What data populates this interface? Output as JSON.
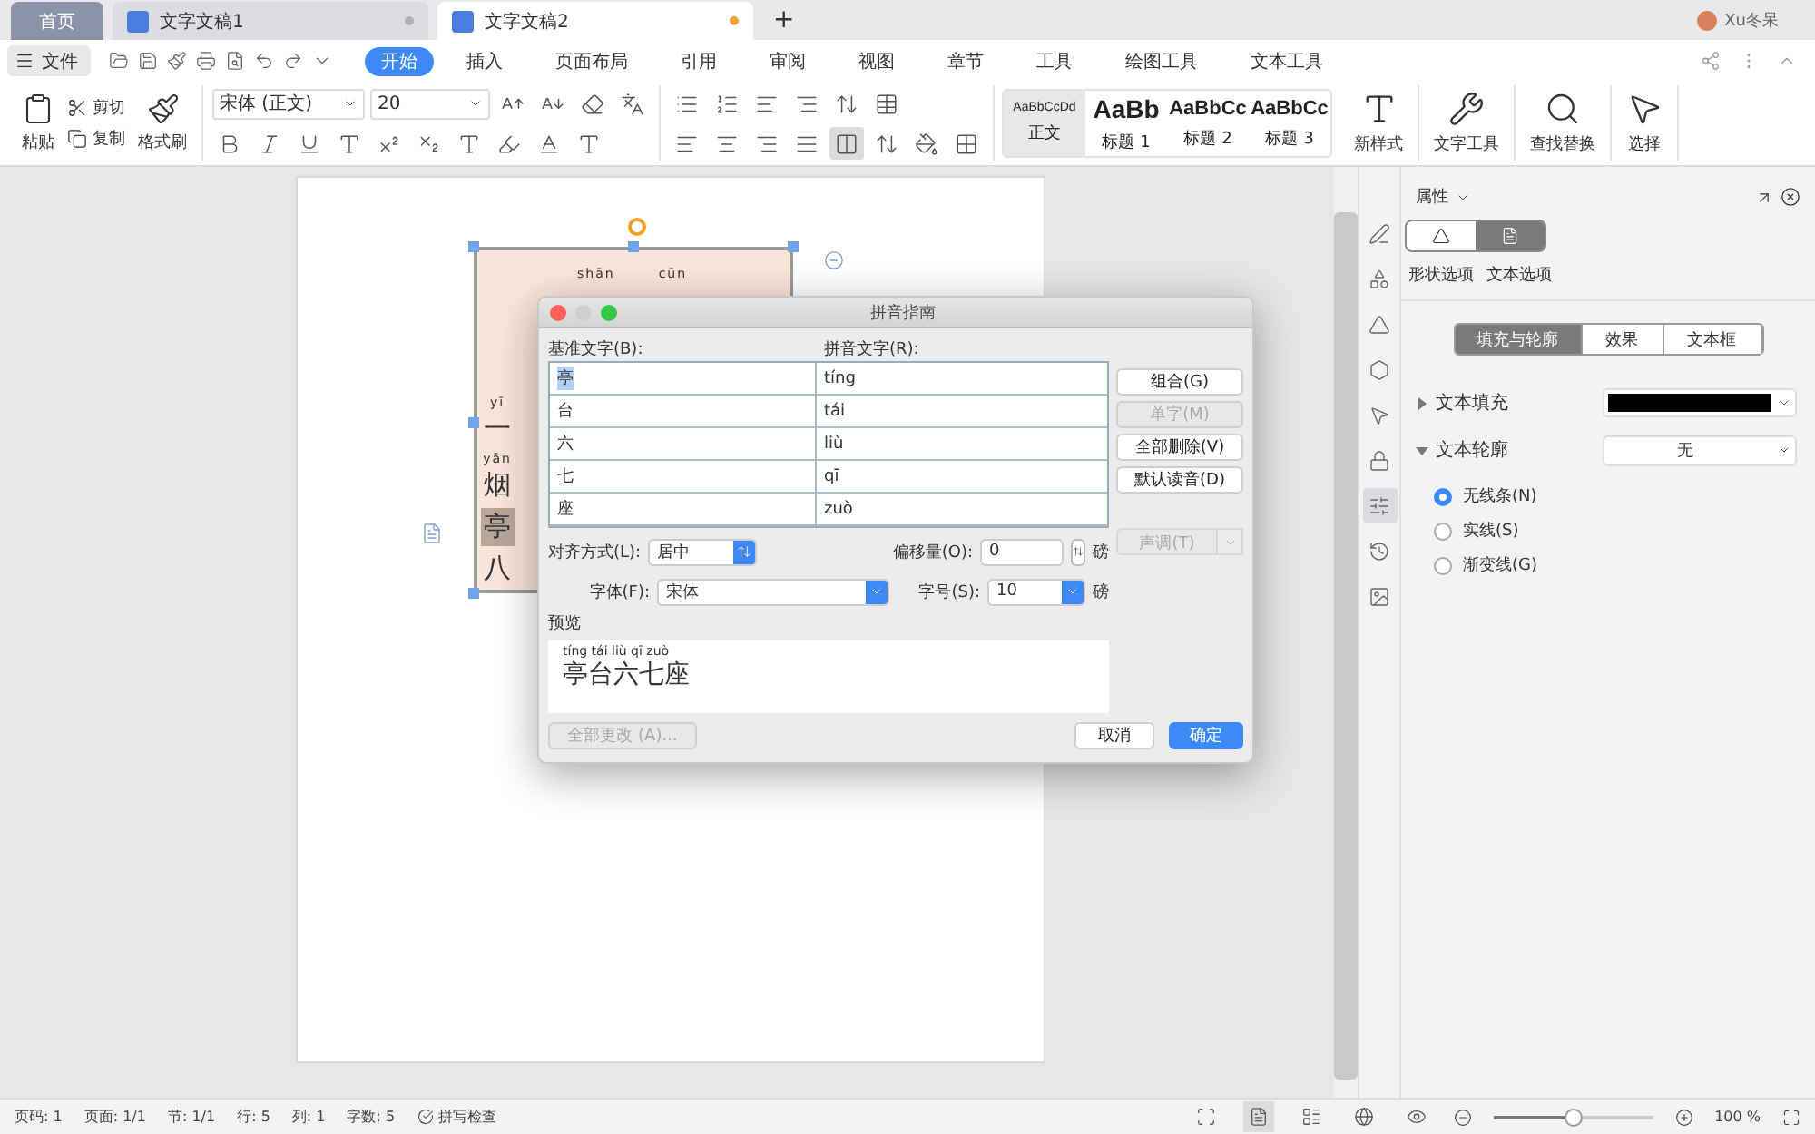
{
  "tabs": [
    {
      "label": "首页",
      "kind": "home",
      "selected": false
    },
    {
      "label": "文字文稿1",
      "kind": "doc",
      "selected": false
    },
    {
      "label": "文字文稿2",
      "kind": "doc",
      "selected": true
    }
  ],
  "new_tab": "+",
  "user": {
    "name": "Xu冬呆"
  },
  "menu": {
    "file": "文件",
    "items": [
      {
        "label": "开始",
        "selected": true
      },
      {
        "label": "插入",
        "selected": false
      },
      {
        "label": "页面布局",
        "selected": false
      },
      {
        "label": "引用",
        "selected": false
      },
      {
        "label": "审阅",
        "selected": false
      },
      {
        "label": "视图",
        "selected": false
      },
      {
        "label": "章节",
        "selected": false
      },
      {
        "label": "工具",
        "selected": false
      },
      {
        "label": "绘图工具",
        "selected": false
      },
      {
        "label": "文本工具",
        "selected": false
      }
    ]
  },
  "ribbon": {
    "paste": "粘贴",
    "cut": "剪切",
    "copy": "复制",
    "format_painter": "格式刷",
    "font_name": "宋体 (正文)",
    "font_size": "20",
    "align_buttons": [
      {
        "kind": "left",
        "selected": false
      },
      {
        "kind": "center",
        "selected": false
      },
      {
        "kind": "right",
        "selected": false
      },
      {
        "kind": "justify",
        "selected": false
      },
      {
        "kind": "distributed",
        "selected": true
      }
    ],
    "styles": [
      {
        "preview": "AaBbCcDd",
        "label": "正文",
        "kind": "body",
        "selected": true
      },
      {
        "preview": "AaBb",
        "label": "标题 1",
        "kind": "h1",
        "selected": false
      },
      {
        "preview": "AaBbCc",
        "label": "标题 2",
        "kind": "h2",
        "selected": false
      },
      {
        "preview": "AaBbCc",
        "label": "标题 3",
        "kind": "h3",
        "selected": false
      }
    ],
    "tools": [
      {
        "label": "新样式",
        "kind": "style"
      },
      {
        "label": "文字工具",
        "kind": "wrench"
      },
      {
        "label": "查找替换",
        "kind": "search"
      },
      {
        "label": "选择",
        "kind": "pointer"
      }
    ]
  },
  "document": {
    "top_pinyin": [
      "shān",
      "cūn"
    ],
    "column": [
      {
        "pinyin": "yī",
        "char": "一",
        "selected": false
      },
      {
        "pinyin": "yān",
        "char": "烟",
        "selected": false
      },
      {
        "char": "亭",
        "selected": true
      },
      {
        "char": "八",
        "selected": false
      }
    ]
  },
  "dialog": {
    "title": "拼音指南",
    "base_label": "基准文字(B):",
    "ruby_label": "拼音文字(R):",
    "rows": [
      {
        "base": "亭",
        "ruby": "tíng",
        "selected": true
      },
      {
        "base": "台",
        "ruby": "tái",
        "selected": false
      },
      {
        "base": "六",
        "ruby": "liù",
        "selected": false
      },
      {
        "base": "七",
        "ruby": "qī",
        "selected": false
      },
      {
        "base": "座",
        "ruby": "zuò",
        "selected": false
      }
    ],
    "buttons": [
      {
        "label": "组合(G)",
        "disabled": false
      },
      {
        "label": "单字(M)",
        "disabled": true
      },
      {
        "label": "全部删除(V)",
        "disabled": false
      },
      {
        "label": "默认读音(D)",
        "disabled": false
      }
    ],
    "tone": {
      "label": "声调(T)",
      "disabled": true
    },
    "align": {
      "label": "对齐方式(L):",
      "value": "居中"
    },
    "offset": {
      "label": "偏移量(O):",
      "value": "0",
      "unit": "磅"
    },
    "font": {
      "label": "字体(F):",
      "value": "宋体"
    },
    "size": {
      "label": "字号(S):",
      "value": "10",
      "unit": "磅"
    },
    "preview_label": "预览",
    "preview_pinyin": "tíng tái liù qī zuò",
    "preview_text": "亭台六七座",
    "apply_all": {
      "label": "全部更改 (A)...",
      "disabled": true
    },
    "cancel": "取消",
    "ok": "确定"
  },
  "panel": {
    "title": "属性",
    "option_tabs": [
      {
        "label": "形状选项",
        "kind": "shape",
        "selected": false
      },
      {
        "label": "文本选项",
        "kind": "text",
        "selected": true
      }
    ],
    "sub_tabs": [
      {
        "label": "填充与轮廓",
        "selected": true
      },
      {
        "label": "效果",
        "selected": false
      },
      {
        "label": "文本框",
        "selected": false
      }
    ],
    "fill": {
      "label": "文本填充",
      "expanded": false,
      "color": "#000000"
    },
    "outline": {
      "label": "文本轮廓",
      "expanded": true,
      "value": "无"
    },
    "line_options": [
      {
        "label": "无线条(N)",
        "selected": true
      },
      {
        "label": "实线(S)",
        "selected": false
      },
      {
        "label": "渐变线(G)",
        "selected": false
      }
    ]
  },
  "side_tools": [
    {
      "kind": "pen",
      "selected": false
    },
    {
      "kind": "shapes",
      "selected": false
    },
    {
      "kind": "fill",
      "selected": false
    },
    {
      "kind": "hex",
      "selected": false
    },
    {
      "kind": "pointer",
      "selected": false
    },
    {
      "kind": "lock",
      "selected": false
    },
    {
      "kind": "sliders",
      "selected": true
    },
    {
      "kind": "history",
      "selected": false
    },
    {
      "kind": "image",
      "selected": false
    }
  ],
  "status": {
    "items": [
      "页码: 1",
      "页面: 1/1",
      "节: 1/1",
      "行: 5",
      "列: 1",
      "字数: 5"
    ],
    "spell": "拼写检查",
    "views": [
      {
        "kind": "focus",
        "selected": false
      },
      {
        "kind": "page",
        "selected": true
      },
      {
        "kind": "outline",
        "selected": false
      },
      {
        "kind": "web",
        "selected": false
      },
      {
        "kind": "read",
        "selected": false
      }
    ],
    "zoom": {
      "level": 0.5,
      "reading": "100 %"
    }
  }
}
